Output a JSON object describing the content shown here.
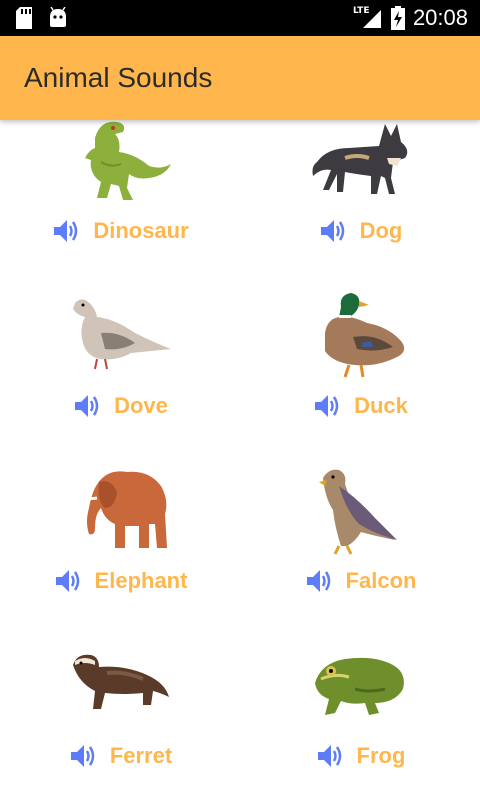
{
  "status_bar": {
    "time": "20:08",
    "network": "LTE"
  },
  "app_bar": {
    "title": "Animal Sounds"
  },
  "colors": {
    "accent": "#FFB74D",
    "speaker": "#5C7CFA",
    "status_bar": "#000000"
  },
  "animals": [
    {
      "name": "Dinosaur",
      "icon": "speaker-icon"
    },
    {
      "name": "Dog",
      "icon": "speaker-icon"
    },
    {
      "name": "Dove",
      "icon": "speaker-icon"
    },
    {
      "name": "Duck",
      "icon": "speaker-icon"
    },
    {
      "name": "Elephant",
      "icon": "speaker-icon"
    },
    {
      "name": "Falcon",
      "icon": "speaker-icon"
    },
    {
      "name": "Ferret",
      "icon": "speaker-icon"
    },
    {
      "name": "Frog",
      "icon": "speaker-icon"
    }
  ]
}
